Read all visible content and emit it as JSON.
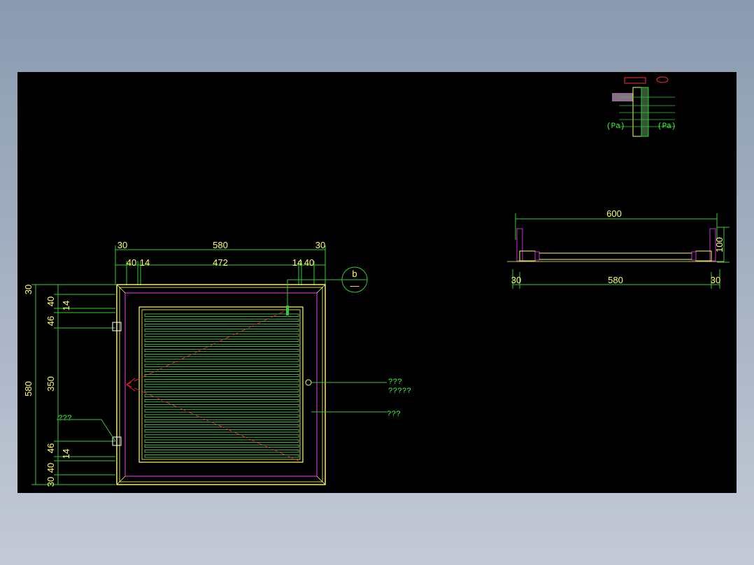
{
  "drawing": {
    "front_view": {
      "width_dims": {
        "left_frame": "30",
        "overall": "580",
        "right_frame": "30"
      },
      "inner_dims": {
        "left_a": "40",
        "left_b": "14",
        "center": "472",
        "right_a": "14",
        "right_b": "40"
      },
      "left_dims": {
        "top_30": "30",
        "top_40": "40",
        "top_14": "14",
        "top_46": "46",
        "overall": "580",
        "mid_350": "350",
        "bot_46": "46",
        "bot_14": "14",
        "bot_40": "40",
        "bot_30": "30"
      },
      "section_mark": {
        "letter": "b",
        "sub": "—"
      },
      "notes": {
        "handle_1": "???",
        "handle_2": "?????",
        "louver": "???",
        "hinge": "???"
      }
    },
    "section_view": {
      "overall_width": "600",
      "height": "100",
      "left_frame": "30",
      "inner_width": "580",
      "right_frame": "30"
    }
  },
  "colors": {
    "background": "#000000",
    "dimension_text": "#ffff66",
    "dimension_line": "#33cc33",
    "frame_outer": "#ffff66",
    "frame_inner": "#cc33cc",
    "louver": "#66ff66",
    "diagonal": "#ff2222"
  }
}
